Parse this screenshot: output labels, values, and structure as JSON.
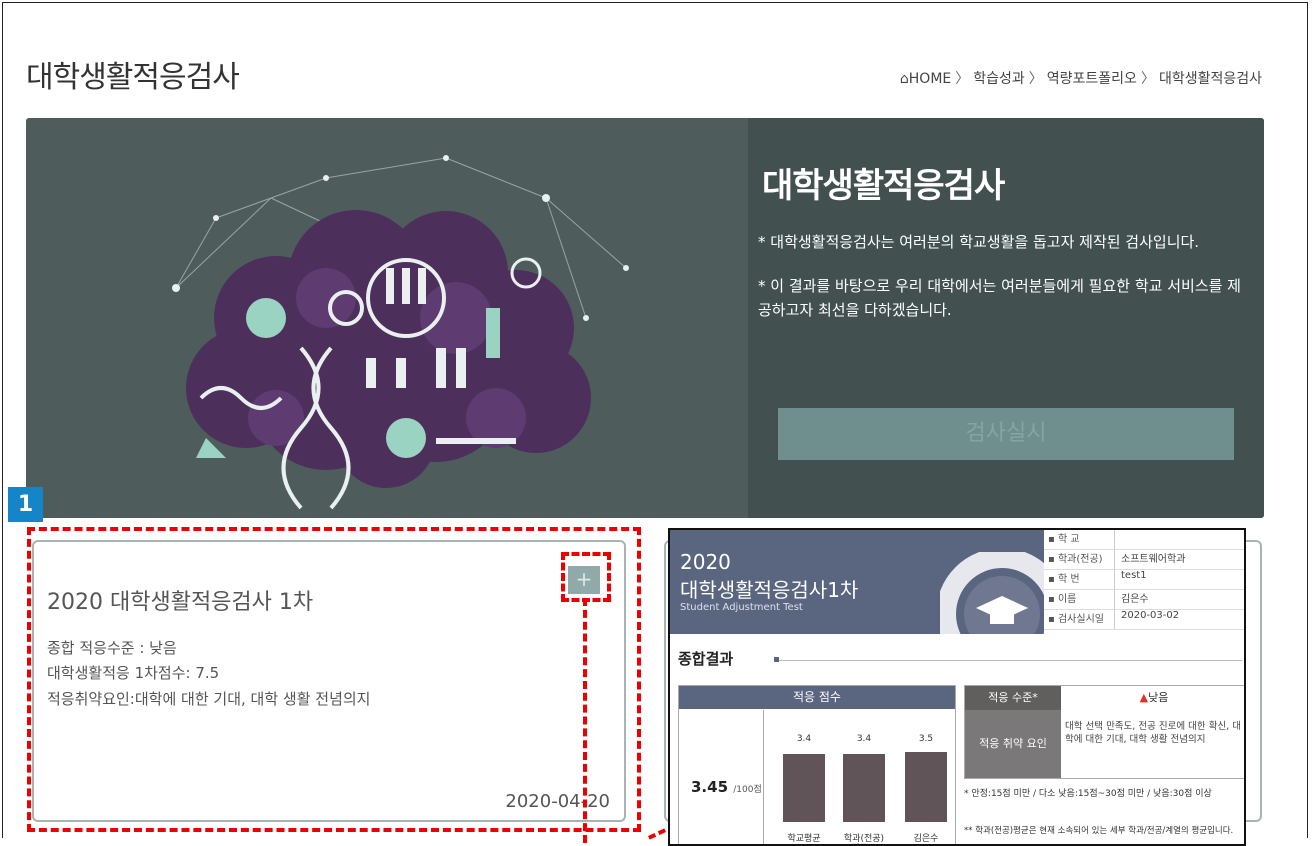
{
  "page": {
    "title": "대학생활적응검사"
  },
  "breadcrumb": {
    "home": "HOME",
    "items": [
      "학습성과",
      "역량포트폴리오",
      "대학생활적응검사"
    ]
  },
  "hero": {
    "title": "대학생활적응검사",
    "desc1": "* 대학생활적응검사는 여러분의 학교생활을 돕고자 제작된 검사입니다.",
    "desc2": "* 이 결과를 바탕으로 우리 대학에서는 여러분들에게 필요한 학교 서비스를 제공하고자 최선을 다하겠습니다.",
    "button": "검사실시"
  },
  "annotation": {
    "badge": "1"
  },
  "card": {
    "title": "2020 대학생활적응검사 1차",
    "line1": "종합 적응수준 : 낮음",
    "line2": "대학생활적응 1차점수: 7.5",
    "line3": "적응취약요인:대학에 대한 기대, 대학 생활 전념의지",
    "date": "2020-04-20",
    "plus": "+"
  },
  "report": {
    "year": "2020",
    "title": "대학생활적응검사1차",
    "subtitle": "Student Adjustment Test",
    "info": [
      {
        "k": "학 교",
        "v": ""
      },
      {
        "k": "학과(전공)",
        "v": "소프트웨어학과"
      },
      {
        "k": "학 번",
        "v": "test1"
      },
      {
        "k": "이름",
        "v": "김은수"
      },
      {
        "k": "검사실시일",
        "v": "2020-03-02"
      }
    ],
    "section": "종합결과",
    "score_header": "적응 점수",
    "score_value": "3.45",
    "score_unit": "/100점",
    "level_header_left": "적응 수준*",
    "level_header_right": "낮음",
    "weak_label": "적응 취약 요인",
    "weak_text": "대학 선택 만족도, 전공 진로에 대한 확신, 대학에 대한 기대, 대학 생활 전념의지",
    "legend": "* 안정:15점 미만 / 다소 낮음:15점~30점 미만 / 낮음:30점 이상",
    "note": "** 학과(전공)평균은 현재 소속되어 있는 세부 학과/전공/계열의 평균입니다."
  },
  "chart_data": {
    "type": "bar",
    "categories": [
      "학교평균",
      "학과(전공) 평균**",
      "김은수"
    ],
    "values": [
      3.4,
      3.4,
      3.5
    ]
  },
  "colors": {
    "hero_bg": "#4e5d5c",
    "report_header": "#5a6580",
    "annotation_red": "#e00000",
    "badge_blue": "#1485c8"
  }
}
